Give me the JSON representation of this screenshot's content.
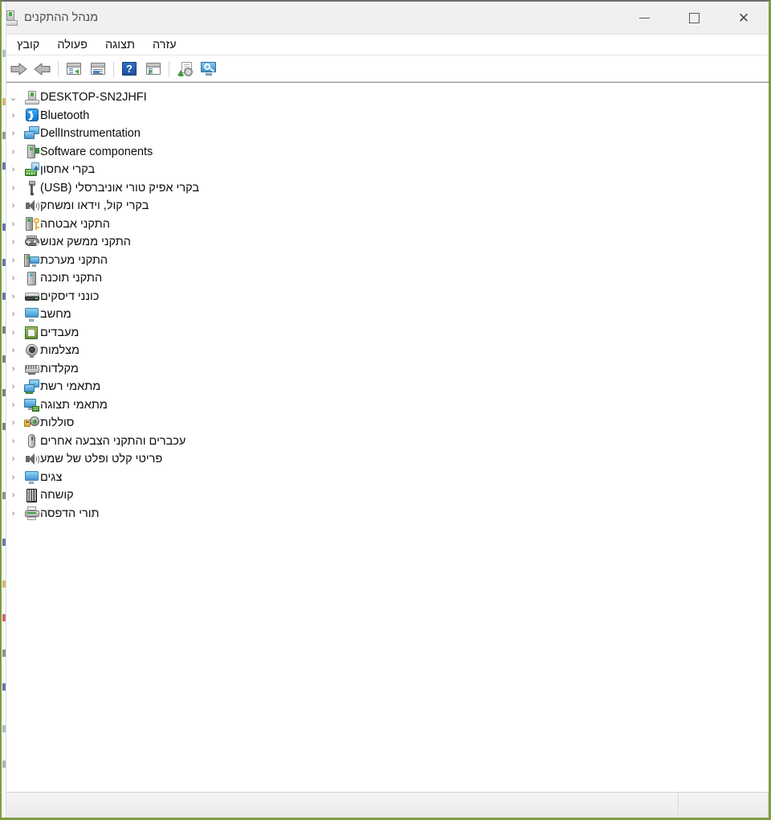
{
  "window": {
    "title": "מנהל ההתקנים",
    "title_icon": "device-manager-icon",
    "controls": {
      "close": "✕",
      "maximize": "◻",
      "minimize": "—"
    },
    "accent_border": "#7d9e43"
  },
  "menubar": {
    "items": [
      {
        "label": "קובץ",
        "name": "menu-file"
      },
      {
        "label": "פעולה",
        "name": "menu-action"
      },
      {
        "label": "תצוגה",
        "name": "menu-view"
      },
      {
        "label": "עזרה",
        "name": "menu-help"
      }
    ]
  },
  "toolbar": {
    "buttons": [
      {
        "name": "forward-button",
        "icon": "arrow-right-icon"
      },
      {
        "name": "back-button",
        "icon": "arrow-left-icon"
      },
      {
        "name": "show-hide-console-tree-button",
        "icon": "console-tree-icon"
      },
      {
        "name": "properties-button",
        "icon": "properties-window-icon"
      },
      {
        "name": "help-button",
        "icon": "help-question-icon"
      },
      {
        "name": "show-hide-action-pane-button",
        "icon": "action-pane-icon"
      },
      {
        "name": "update-driver-button",
        "icon": "update-driver-icon"
      },
      {
        "name": "scan-for-hardware-changes-button",
        "icon": "scan-hardware-icon"
      }
    ]
  },
  "tree": {
    "root": {
      "label": "DESKTOP-SN2JHFI",
      "icon": "computer-icon",
      "expander": "chevron-down-icon",
      "expanded": true
    },
    "nodes": [
      {
        "label": "Bluetooth",
        "icon": "bluetooth-icon",
        "expander": "chevron-left-icon",
        "expanded": false
      },
      {
        "label": "DellInstrumentation",
        "icon": "dell-instrumentation-icon",
        "expander": "chevron-left-icon",
        "expanded": false
      },
      {
        "label": "Software components",
        "icon": "software-component-icon",
        "expander": "chevron-left-icon",
        "expanded": false
      },
      {
        "label": "בקרי אחסון",
        "icon": "storage-controller-icon",
        "expander": "chevron-left-icon",
        "expanded": false
      },
      {
        "label": "בקרי אפיק טורי אוניברסלי (USB)",
        "icon": "usb-controller-icon",
        "expander": "chevron-left-icon",
        "expanded": false
      },
      {
        "label": "בקרי קול, וידאו ומשחק",
        "icon": "sound-video-game-icon",
        "expander": "chevron-left-icon",
        "expanded": false
      },
      {
        "label": "התקני אבטחה",
        "icon": "security-device-icon",
        "expander": "chevron-left-icon",
        "expanded": false
      },
      {
        "label": "התקני ממשק אנוש",
        "icon": "human-interface-device-icon",
        "expander": "chevron-left-icon",
        "expanded": false
      },
      {
        "label": "התקני מערכת",
        "icon": "system-device-icon",
        "expander": "chevron-left-icon",
        "expanded": false
      },
      {
        "label": "התקני תוכנה",
        "icon": "software-device-icon",
        "expander": "chevron-left-icon",
        "expanded": false
      },
      {
        "label": "כונני דיסקים",
        "icon": "disk-drive-icon",
        "expander": "chevron-left-icon",
        "expanded": false
      },
      {
        "label": "מחשב",
        "icon": "computer-node-icon",
        "expander": "chevron-left-icon",
        "expanded": false
      },
      {
        "label": "מעבדים",
        "icon": "processor-icon",
        "expander": "chevron-left-icon",
        "expanded": false
      },
      {
        "label": "מצלמות",
        "icon": "camera-icon",
        "expander": "chevron-left-icon",
        "expanded": false
      },
      {
        "label": "מקלדות",
        "icon": "keyboard-icon",
        "expander": "chevron-left-icon",
        "expanded": false
      },
      {
        "label": "מתאמי רשת",
        "icon": "network-adapter-icon",
        "expander": "chevron-left-icon",
        "expanded": false
      },
      {
        "label": "מתאמי תצוגה",
        "icon": "display-adapter-icon",
        "expander": "chevron-left-icon",
        "expanded": false
      },
      {
        "label": "סוללות",
        "icon": "battery-icon",
        "expander": "chevron-left-icon",
        "expanded": false
      },
      {
        "label": "עכברים והתקני הצבעה אחרים",
        "icon": "mouse-icon",
        "expander": "chevron-left-icon",
        "expanded": false
      },
      {
        "label": "פריטי קלט ופלט של שמע",
        "icon": "audio-io-icon",
        "expander": "chevron-left-icon",
        "expanded": false
      },
      {
        "label": "צגים",
        "icon": "monitor-icon",
        "expander": "chevron-left-icon",
        "expanded": false
      },
      {
        "label": "קושחה",
        "icon": "firmware-icon",
        "expander": "chevron-left-icon",
        "expanded": false
      },
      {
        "label": "תורי הדפסה",
        "icon": "print-queue-icon",
        "expander": "chevron-left-icon",
        "expanded": false
      }
    ]
  },
  "statusbar": {
    "panes": [
      {
        "name": "status-pane-1",
        "text": ""
      },
      {
        "name": "status-pane-2",
        "text": ""
      },
      {
        "name": "status-pane-3",
        "text": ""
      }
    ]
  }
}
